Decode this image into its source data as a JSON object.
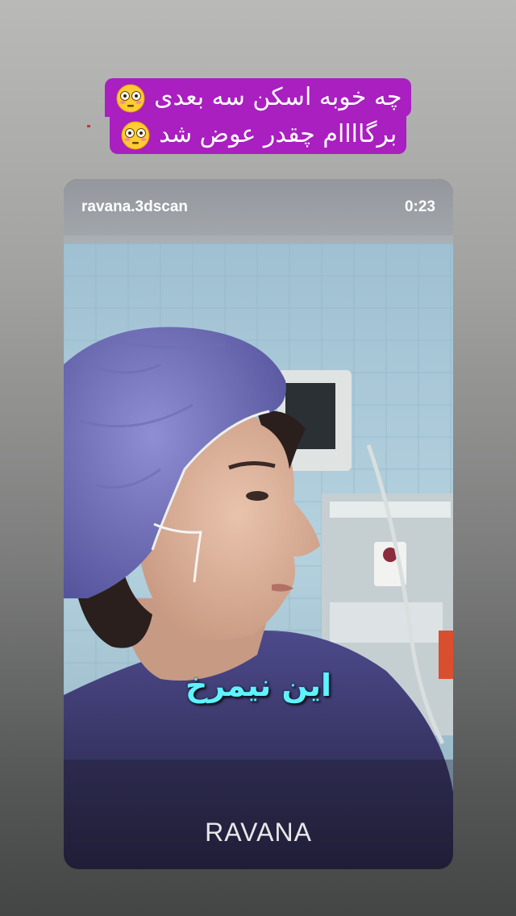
{
  "caption": {
    "line1": "چه خوبه اسکن سه بعدی",
    "line2": "برگاااام چقدر عوض شد",
    "emoji": "flushed-face-icon",
    "bg_color": "#a91fc0"
  },
  "story": {
    "username": "ravana.3dscan",
    "timer": "0:23",
    "subtitle": "این نیمرخ",
    "subtitle_color": "#5ff3ff",
    "logo": "RAVANA"
  }
}
